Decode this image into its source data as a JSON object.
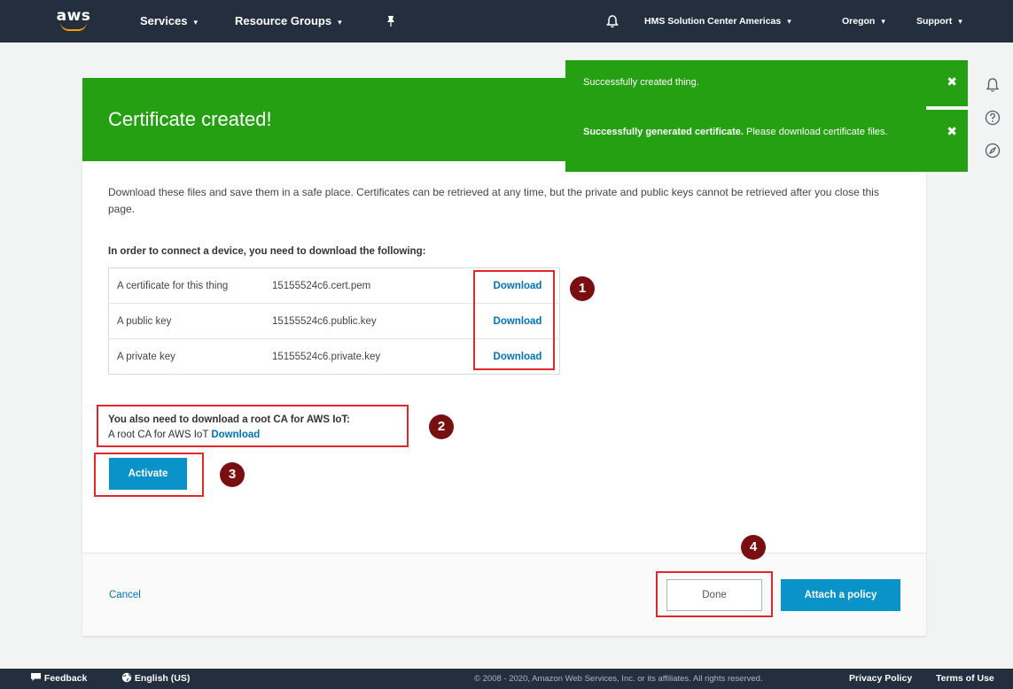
{
  "nav": {
    "logo": "aws",
    "services": "Services",
    "resource_groups": "Resource Groups",
    "account": "HMS Solution Center Americas",
    "region": "Oregon",
    "support": "Support",
    "caret": "▾"
  },
  "flash": [
    {
      "bold": "",
      "text": "Successfully created thing.",
      "close": "✖"
    },
    {
      "bold": "Successfully generated certificate.",
      "text": " Please download certificate files.",
      "close": "✖"
    }
  ],
  "panel": {
    "title": "Certificate created!",
    "description": "Download these files and save them in a safe place. Certificates can be retrieved at any time, but the private and public keys cannot be retrieved after you close this page.",
    "subheading": "In order to connect a device, you need to download the following:",
    "files": [
      {
        "label": "A certificate for this thing",
        "filename": "15155524c6.cert.pem",
        "action": "Download"
      },
      {
        "label": "A public key",
        "filename": "15155524c6.public.key",
        "action": "Download"
      },
      {
        "label": "A private key",
        "filename": "15155524c6.private.key",
        "action": "Download"
      }
    ],
    "rootca_heading": "You also need to download a root CA for AWS IoT:",
    "rootca_text": "A root CA for AWS IoT",
    "rootca_link": "Download",
    "activate": "Activate",
    "cancel": "Cancel",
    "done": "Done",
    "attach_policy": "Attach a policy"
  },
  "badges": [
    "1",
    "2",
    "3",
    "4"
  ],
  "footer": {
    "feedback": "Feedback",
    "language": "English (US)",
    "copyright": "© 2008 - 2020, Amazon Web Services, Inc. or its affiliates. All rights reserved.",
    "privacy": "Privacy Policy",
    "terms": "Terms of Use"
  },
  "colors": {
    "nav_bg": "#232f3e",
    "success_green": "#25a012",
    "primary_blue": "#0a93c8",
    "link_blue": "#0073bb",
    "highlight_red": "#e1262c",
    "badge_red": "#7a0f12"
  }
}
